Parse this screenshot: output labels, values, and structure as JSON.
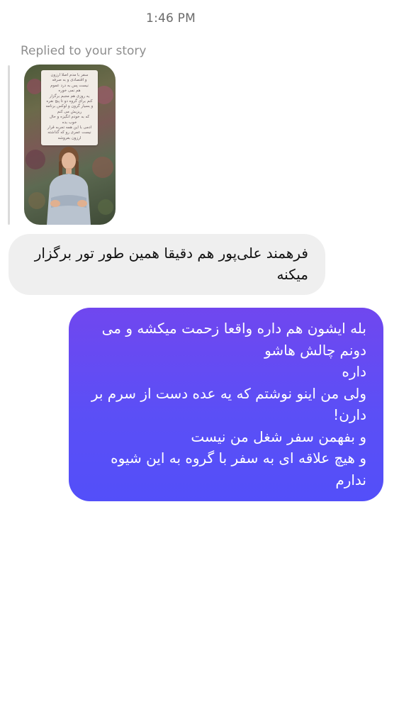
{
  "status": {
    "time": "1:46 PM"
  },
  "reply": {
    "label": "Replied to your story"
  },
  "story_note_lines": [
    "سفر با مدم اصلا ارزون",
    "و اقتصادی و به صرفه",
    "نیست پس به درد عموم",
    "هم نمی خوره",
    "یه روزی هم مجبم برگزار",
    "کنم برای گروه دو تا پنج نفره",
    "و بسیار گرون و لوکس برنامه",
    "ریزیش می کنم",
    "که به خودم انگیزه و حال",
    "خوب بده",
    "ادمی با این همه تجربه قرار",
    "نیست عمری رو که گذاشته",
    "ارزون بفروشه"
  ],
  "messages": {
    "incoming": "فرهمند علی‌پور هم دقیقا همین طور تور برگزار میکنه",
    "outgoing": [
      "بله ایشون هم داره واقعا زحمت میکشه و می دونم چالش هاشو",
      "داره",
      "ولی من اینو نوشتم که یه عده دست از سرم بر دارن!",
      "و بفهمن سفر شغل من نیست",
      "و هیچ علاقه ای به سفر با گروه به این شیوه ندارم"
    ]
  },
  "colors": {
    "outgoing_bubble": "#5b4ff6",
    "incoming_bubble": "#efefef",
    "timestamp": "#6b6b6b"
  }
}
